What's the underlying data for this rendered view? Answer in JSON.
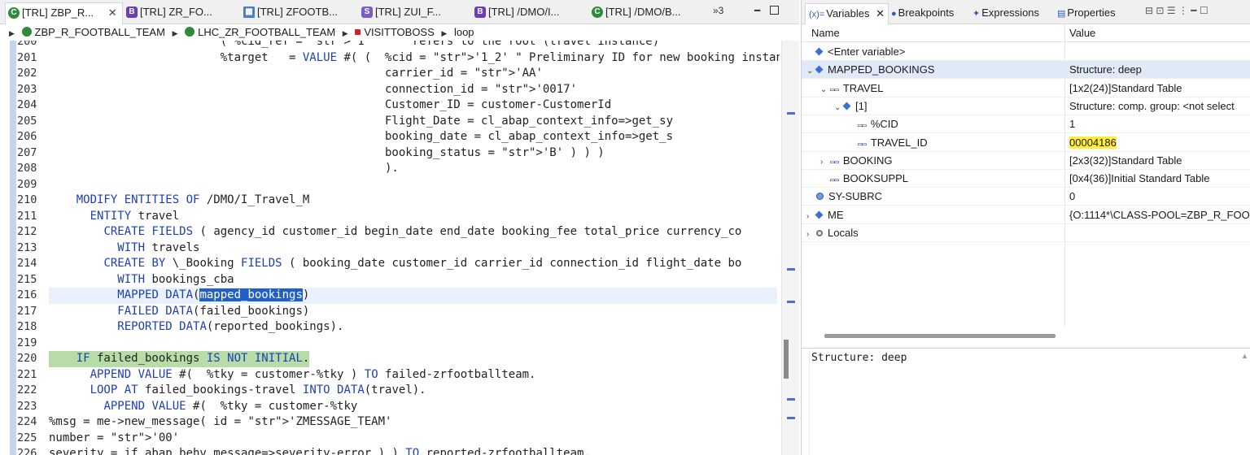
{
  "editor": {
    "tabs": [
      {
        "label": "[TRL] ZBP_R...",
        "icon": "class-icon",
        "active": true
      },
      {
        "label": "[TRL] ZR_FO...",
        "icon": "behavior-icon"
      },
      {
        "label": "[TRL] ZFOOTB...",
        "icon": "table-icon"
      },
      {
        "label": "[TRL] ZUI_F...",
        "icon": "service-icon"
      },
      {
        "label": "[TRL] /DMO/I...",
        "icon": "behavior-icon"
      },
      {
        "label": "[TRL] /DMO/B...",
        "icon": "class-icon"
      }
    ],
    "overflow_label": "»3",
    "breadcrumb": [
      "ZBP_R_FOOTBALL_TEAM",
      "LHC_ZR_FOOTBALL_TEAM",
      "VISITTOBOSS",
      "loop"
    ],
    "lines": [
      {
        "n": "200",
        "text": "                         ( %cid_ref = '1'      refers to the root (travel instance)"
      },
      {
        "n": "201",
        "text": "                         %target   = VALUE #( (  %cid = '1_2' \" Preliminary ID for new booking instan"
      },
      {
        "n": "202",
        "text": "                                                 carrier_id = 'AA'"
      },
      {
        "n": "203",
        "text": "                                                 connection_id = '0017'"
      },
      {
        "n": "204",
        "text": "                                                 Customer_ID = customer-CustomerId"
      },
      {
        "n": "205",
        "text": "                                                 Flight_Date = cl_abap_context_info=>get_sy"
      },
      {
        "n": "206",
        "text": "                                                 booking_date = cl_abap_context_info=>get_s"
      },
      {
        "n": "207",
        "text": "                                                 booking_status = 'B' ) ) )"
      },
      {
        "n": "208",
        "text": "                                                 )."
      },
      {
        "n": "209",
        "text": ""
      },
      {
        "n": "210",
        "text": "    MODIFY ENTITIES OF /DMO/I_Travel_M"
      },
      {
        "n": "211",
        "text": "      ENTITY travel"
      },
      {
        "n": "212",
        "text": "        CREATE FIELDS ( agency_id customer_id begin_date end_date booking_fee total_price currency_co"
      },
      {
        "n": "213",
        "text": "          WITH travels"
      },
      {
        "n": "214",
        "text": "        CREATE BY \\_Booking FIELDS ( booking_date customer_id carrier_id connection_id flight_date bo"
      },
      {
        "n": "215",
        "text": "          WITH bookings_cba"
      },
      {
        "n": "216",
        "text": "          MAPPED DATA(mapped_bookings)"
      },
      {
        "n": "217",
        "text": "          FAILED DATA(failed_bookings)"
      },
      {
        "n": "218",
        "text": "          REPORTED DATA(reported_bookings)."
      },
      {
        "n": "219",
        "text": ""
      },
      {
        "n": "220",
        "text": "    IF failed_bookings IS NOT INITIAL."
      },
      {
        "n": "221",
        "text": "      APPEND VALUE #(  %tky = customer-%tky ) TO failed-zrfootballteam."
      },
      {
        "n": "222",
        "text": "      LOOP AT failed_bookings-travel INTO DATA(travel)."
      },
      {
        "n": "223",
        "text": "        APPEND VALUE #(  %tky = customer-%tky"
      },
      {
        "n": "224",
        "text": "%msg = me->new_message( id = 'ZMESSAGE_TEAM'"
      },
      {
        "n": "225",
        "text": "number = '00'"
      },
      {
        "n": "226",
        "text": "severity = if_abap_behv_message=>severity-error ) ) TO reported-zrfootballteam."
      }
    ],
    "selected_text": "mapped_bookings"
  },
  "vars_view": {
    "tabs": [
      {
        "label": "Variables",
        "active": true
      },
      {
        "label": "Breakpoints"
      },
      {
        "label": "Expressions"
      },
      {
        "label": "Properties"
      }
    ],
    "columns": {
      "name": "Name",
      "value": "Value"
    },
    "rows": [
      {
        "name": "<Enter variable>",
        "value": "",
        "depth": 0,
        "icon": "dot",
        "twisty": ""
      },
      {
        "name": "MAPPED_BOOKINGS",
        "value": "Structure: deep",
        "depth": 0,
        "icon": "dot",
        "twisty": "open",
        "selected": true
      },
      {
        "name": "TRAVEL",
        "value": "[1x2(24)]Standard Table",
        "depth": 1,
        "icon": "field",
        "twisty": "open"
      },
      {
        "name": "[1]",
        "value": "Structure: comp. group: <not select",
        "depth": 2,
        "icon": "dot",
        "twisty": "open"
      },
      {
        "name": "%CID",
        "value": "1",
        "depth": 3,
        "icon": "field",
        "twisty": ""
      },
      {
        "name": "TRAVEL_ID",
        "value": "00004186",
        "depth": 3,
        "icon": "field",
        "twisty": "",
        "highlight": true
      },
      {
        "name": "BOOKING",
        "value": "[2x3(32)]Standard Table",
        "depth": 1,
        "icon": "field",
        "twisty": "closed"
      },
      {
        "name": "BOOKSUPPL",
        "value": "[0x4(36)]Initial Standard Table",
        "depth": 1,
        "icon": "field",
        "twisty": ""
      },
      {
        "name": "SY-SUBRC",
        "value": "0",
        "depth": 0,
        "icon": "sub",
        "twisty": ""
      },
      {
        "name": "ME",
        "value": "{O:1114*\\CLASS-POOL=ZBP_R_FOO",
        "depth": 0,
        "icon": "dot",
        "twisty": "closed"
      },
      {
        "name": "Locals",
        "value": "",
        "depth": 0,
        "icon": "local",
        "twisty": "closed"
      }
    ],
    "detail_text": "Structure: deep"
  }
}
